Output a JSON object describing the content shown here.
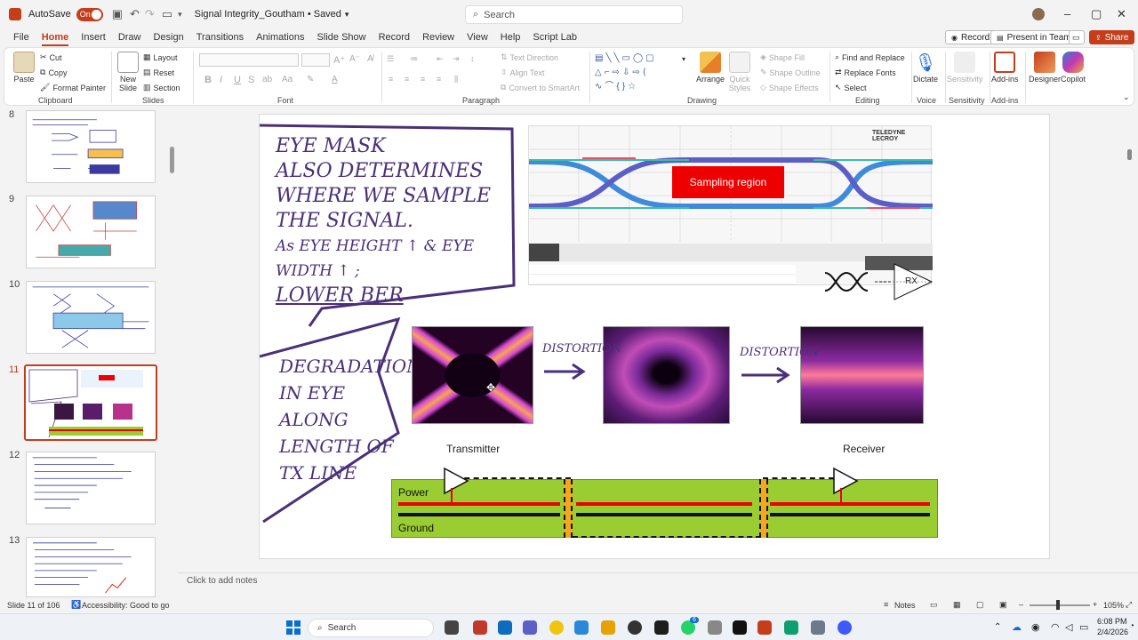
{
  "titlebar": {
    "autosave_label": "AutoSave",
    "autosave_state": "On",
    "doc_title": "Signal Integrity_Goutham • Saved",
    "search_placeholder": "Search"
  },
  "menu": {
    "tabs": [
      "File",
      "Home",
      "Insert",
      "Draw",
      "Design",
      "Transitions",
      "Animations",
      "Slide Show",
      "Record",
      "Review",
      "View",
      "Help",
      "Script Lab"
    ],
    "active": "Home",
    "record": "Record",
    "present": "Present in Teams",
    "share": "Share"
  },
  "ribbon": {
    "clipboard": {
      "label": "Clipboard",
      "paste": "Paste",
      "cut": "Cut",
      "copy": "Copy",
      "format_painter": "Format Painter"
    },
    "slides": {
      "label": "Slides",
      "new_slide": "New Slide",
      "layout": "Layout",
      "reset": "Reset",
      "section": "Section"
    },
    "font": {
      "label": "Font"
    },
    "paragraph": {
      "label": "Paragraph",
      "text_direction": "Text Direction",
      "align_text": "Align Text",
      "convert_smartart": "Convert to SmartArt"
    },
    "drawing": {
      "label": "Drawing",
      "arrange": "Arrange",
      "quick_styles": "Quick Styles",
      "shape_fill": "Shape Fill",
      "shape_outline": "Shape Outline",
      "shape_effects": "Shape Effects"
    },
    "editing": {
      "label": "Editing",
      "find_replace": "Find and Replace",
      "replace_fonts": "Replace Fonts",
      "select": "Select"
    },
    "voice": {
      "label": "Voice",
      "dictate": "Dictate"
    },
    "sensitivity": {
      "label": "Sensitivity",
      "sensitivity": "Sensitivity"
    },
    "addins": {
      "label": "Add-ins",
      "addins": "Add-ins",
      "designer": "Designer",
      "copilot": "Copilot"
    }
  },
  "thumbnails": [
    "8",
    "9",
    "10",
    "11",
    "12",
    "13"
  ],
  "active_slide": "11",
  "slide": {
    "note_left_top": [
      "EYE MASK",
      "ALSO DETERMINES",
      "WHERE WE SAMPLE",
      "THE SIGNAL.",
      "As EYE HEIGHT ↑ & EYE WIDTH ↑ ;",
      "LOWER BER"
    ],
    "note_left_bottom": [
      "DEGRADATION",
      "IN EYE",
      "ALONG",
      "LENGTH OF",
      "TX LINE"
    ],
    "brand": "TELEDYNE LECROY",
    "sampling_region": "Sampling region",
    "rx_label": "RX",
    "distortion_1": "DISTORTION",
    "distortion_2": "DISTORTION",
    "transmitter": "Transmitter",
    "receiver": "Receiver",
    "power": "Power",
    "ground": "Ground"
  },
  "notes_placeholder": "Click to add notes",
  "status": {
    "slide_of": "Slide 11 of 106",
    "accessibility": "Accessibility: Good to go",
    "notes": "Notes",
    "zoom": "105%"
  },
  "taskbar": {
    "search": "Search",
    "time": "6:08 PM",
    "date": "2/4/2026",
    "whatsapp_badge": "6"
  },
  "colors": {
    "accent": "#c43e1c",
    "ink": "#4a2f7a",
    "board_green": "#9acd32",
    "sampling_red": "#e00000"
  }
}
